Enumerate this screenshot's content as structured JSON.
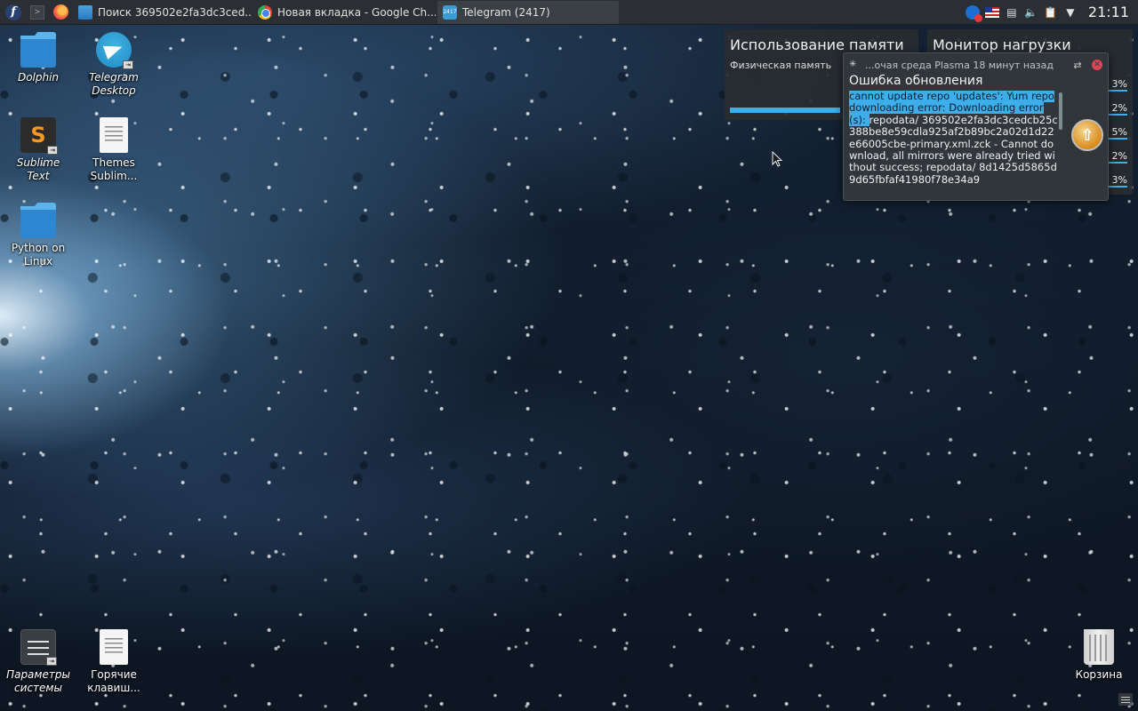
{
  "taskbar": {
    "launcher_icon": "fedora-icon",
    "quick_launch": [
      "terminal-icon",
      "firefox-icon"
    ],
    "tasks": [
      {
        "label": "Поиск 369502e2fa3dc3ced...",
        "icon": "folder-icon"
      },
      {
        "label": "Новая вкладка - Google Ch...",
        "icon": "chrome-icon"
      },
      {
        "label": "Telegram (2417)",
        "icon": "telegram-icon",
        "badge": "2417"
      }
    ],
    "tray": [
      "update-notifier-icon",
      "us-flag-icon",
      "network-icon",
      "volume-icon",
      "clipboard-icon",
      "expand-arrow-icon"
    ],
    "clock": "21:11"
  },
  "desktop_icons": [
    {
      "label": "Dolphin",
      "icon": "folder-icon"
    },
    {
      "label": "Telegram Desktop",
      "icon": "telegram-icon"
    },
    {
      "label": "Sublime Text",
      "icon": "sublime-icon"
    },
    {
      "label": "Themes Sublim...",
      "icon": "document-icon"
    },
    {
      "label": "Python on Linux",
      "icon": "folder-icon"
    },
    {
      "label": "Параметры системы",
      "icon": "settings-icon"
    },
    {
      "label": "Горячие клавиш...",
      "icon": "document-icon"
    },
    {
      "label": "Корзина",
      "icon": "trash-icon"
    }
  ],
  "memory_widget": {
    "title": "Использование памяти",
    "subtitle": "Физическая память",
    "usage_fraction": 0.6
  },
  "load_widget": {
    "title": "Монитор нагрузки",
    "rows": [
      "3%",
      "2%",
      "5%",
      "2%",
      "3%"
    ]
  },
  "notification": {
    "source": "...очая среда Plasma 18 минут назад",
    "title": "Ошибка обновления",
    "body_selected": "cannot update repo 'updates': Yum repo downloading error: Downloading error(s): ",
    "body_rest": "repodata/ 369502e2fa3dc3cedcb25c388be8e59cdla925af2b89bc2a02d1d22e66005cbe-primary.xml.zck - Cannot download, all mirrors were already tried without success; repodata/ 8d1425d5865d9d65fbfaf41980f78e34a9",
    "action_icon": "upgrade-arrow-icon"
  },
  "colors": {
    "accent": "#3daee9",
    "panel": "#2b2f33",
    "close": "#da4453"
  }
}
